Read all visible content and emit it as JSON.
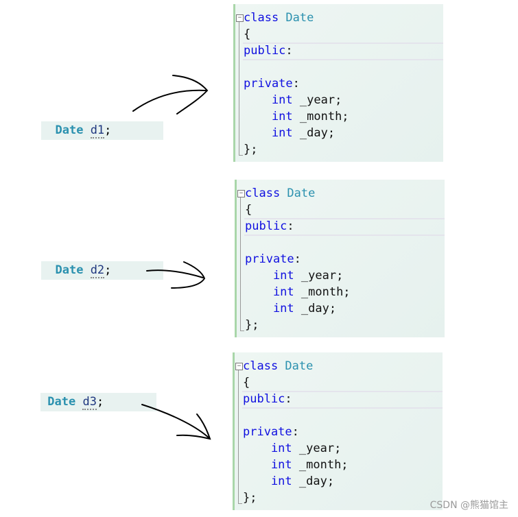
{
  "panels": [
    {
      "lines": [
        [
          {
            "t": "class ",
            "c": "kw"
          },
          {
            "t": "Date",
            "c": "ty"
          }
        ],
        [
          {
            "t": "{",
            "c": "tx"
          }
        ],
        [
          {
            "t": "public",
            "c": "kw"
          },
          {
            "t": ":",
            "c": "tx"
          }
        ],
        [],
        [
          {
            "t": "private",
            "c": "kw"
          },
          {
            "t": ":",
            "c": "tx"
          }
        ],
        [
          {
            "t": "    int ",
            "c": "kw"
          },
          {
            "t": "_year;",
            "c": "tx"
          }
        ],
        [
          {
            "t": "    int ",
            "c": "kw"
          },
          {
            "t": "_month;",
            "c": "tx"
          }
        ],
        [
          {
            "t": "    int ",
            "c": "kw"
          },
          {
            "t": "_day;",
            "c": "tx"
          }
        ],
        [
          {
            "t": "};",
            "c": "tx"
          }
        ]
      ]
    },
    {
      "lines": [
        [
          {
            "t": "class ",
            "c": "kw"
          },
          {
            "t": "Date",
            "c": "ty"
          }
        ],
        [
          {
            "t": "{",
            "c": "tx"
          }
        ],
        [
          {
            "t": "public",
            "c": "kw"
          },
          {
            "t": ":",
            "c": "tx"
          }
        ],
        [],
        [
          {
            "t": "private",
            "c": "kw"
          },
          {
            "t": ":",
            "c": "tx"
          }
        ],
        [
          {
            "t": "    int ",
            "c": "kw"
          },
          {
            "t": "_year;",
            "c": "tx"
          }
        ],
        [
          {
            "t": "    int ",
            "c": "kw"
          },
          {
            "t": "_month;",
            "c": "tx"
          }
        ],
        [
          {
            "t": "    int ",
            "c": "kw"
          },
          {
            "t": "_day;",
            "c": "tx"
          }
        ],
        [
          {
            "t": "};",
            "c": "tx"
          }
        ]
      ]
    },
    {
      "lines": [
        [
          {
            "t": "class ",
            "c": "kw"
          },
          {
            "t": "Date",
            "c": "ty"
          }
        ],
        [
          {
            "t": "{",
            "c": "tx"
          }
        ],
        [
          {
            "t": "public",
            "c": "kw"
          },
          {
            "t": ":",
            "c": "tx"
          }
        ],
        [],
        [
          {
            "t": "private",
            "c": "kw"
          },
          {
            "t": ":",
            "c": "tx"
          }
        ],
        [
          {
            "t": "    int ",
            "c": "kw"
          },
          {
            "t": "_year;",
            "c": "tx"
          }
        ],
        [
          {
            "t": "    int ",
            "c": "kw"
          },
          {
            "t": "_month;",
            "c": "tx"
          }
        ],
        [
          {
            "t": "    int ",
            "c": "kw"
          },
          {
            "t": "_day;",
            "c": "tx"
          }
        ],
        [
          {
            "t": "};",
            "c": "tx"
          }
        ]
      ]
    }
  ],
  "snippets": [
    {
      "type": "Date",
      "var": "d1",
      "end": ";"
    },
    {
      "type": "Date",
      "var": "d2",
      "end": ";"
    },
    {
      "type": "Date",
      "var": "d3",
      "end": ";"
    }
  ],
  "fold_symbol": "−",
  "watermark": "CSDN @熊猫馆主"
}
